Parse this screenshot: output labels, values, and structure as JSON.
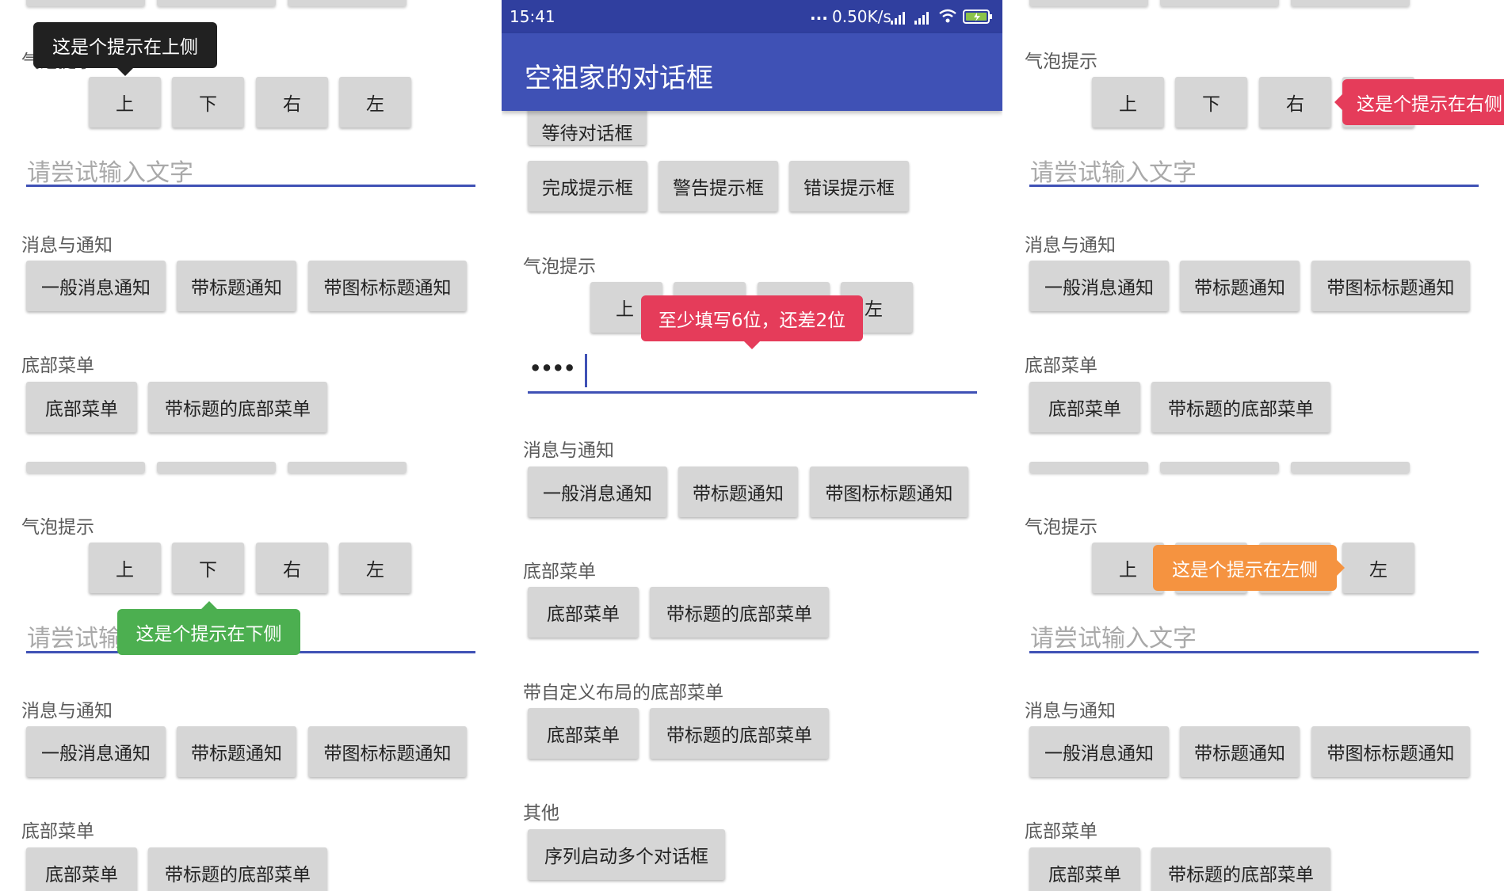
{
  "status_bar": {
    "time": "15:41",
    "net_speed": "0.50K/s",
    "dots": "..."
  },
  "app_bar": {
    "title": "空祖家的对话框"
  },
  "colors": {
    "primary": "#3f51b5",
    "primary_dark": "#303f9f",
    "tip_dark": "#212121",
    "tip_green": "#4caf50",
    "tip_red": "#e53c5a",
    "tip_orange": "#f59340"
  },
  "sections": {
    "bubble": "气泡提示",
    "bubble_partial": "气泡提示",
    "notify": "消息与通知",
    "bottom_menu": "底部菜单",
    "custom_bottom_menu": "带自定义布局的底部菜单",
    "other": "其他"
  },
  "dir_buttons": {
    "up": "上",
    "down": "下",
    "right": "右",
    "left": "左"
  },
  "input": {
    "placeholder": "请尝试输入文字",
    "placeholder_partial": "请尝试输",
    "password_dots": "••••"
  },
  "notify_buttons": {
    "general": "一般消息通知",
    "with_title": "带标题通知",
    "with_icon_title": "带图标标题通知"
  },
  "bottom_menu_buttons": {
    "menu": "底部菜单",
    "titled_menu": "带标题的底部菜单"
  },
  "dialog_buttons": {
    "waiting": "等待对话框",
    "done": "完成提示框",
    "warning": "警告提示框",
    "error": "错误提示框"
  },
  "other_buttons": {
    "sequence": "序列启动多个对话框"
  },
  "tips": {
    "top": "这是个提示在上侧",
    "bottom": "这是个提示在下侧",
    "right": "这是个提示在右侧",
    "left": "这是个提示在左侧",
    "min_length": "至少填写6位，还差2位"
  }
}
